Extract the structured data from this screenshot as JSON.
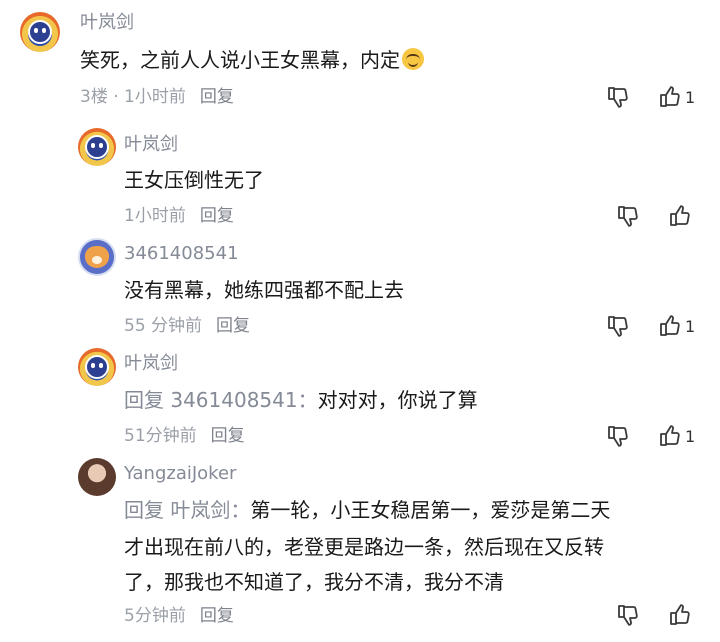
{
  "comments": [
    {
      "author": "叶岚剑",
      "text": "笑死，之前人人说小王女黑幕，内定",
      "floor": "3楼",
      "time": "1小时前",
      "reply_label": "回复",
      "like_count": "1",
      "avatar_icon": "avatar-round-blue-character"
    },
    {
      "author": "叶岚剑",
      "text": "王女压倒性无了",
      "time": "1小时前",
      "reply_label": "回复",
      "avatar_icon": "avatar-round-blue-character"
    },
    {
      "author": "3461408541",
      "text": "没有黑幕，她练四强都不配上去",
      "time": "55 分钟前",
      "reply_label": "回复",
      "like_count": "1",
      "avatar_icon": "avatar-shiba-dog"
    },
    {
      "author": "叶岚剑",
      "reply_prefix": "回复 3461408541：",
      "text": "对对对，你说了算",
      "time": "51分钟前",
      "reply_label": "回复",
      "like_count": "1",
      "avatar_icon": "avatar-round-blue-character"
    },
    {
      "author": "YangzaiJoker",
      "reply_prefix": "回复 叶岚剑：",
      "lines": [
        "第一轮，小王女稳居第一，爱莎是第二天",
        "才出现在前八的，老登更是路边一条，然后现在又反转",
        "了，那我也不知道了，我分不清，我分不清"
      ],
      "time": "5分钟前",
      "reply_label": "回复",
      "avatar_icon": "avatar-girl-photo"
    }
  ],
  "meta_separator": "·",
  "icons": {
    "dislike": "thumbs-down-icon",
    "like": "thumbs-up-icon"
  },
  "colors": {
    "name": "#848a96",
    "meta": "#9ba0a8",
    "text": "#1a1a1a"
  }
}
